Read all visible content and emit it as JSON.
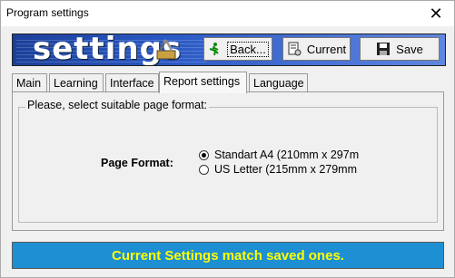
{
  "window": {
    "title": "Program settings",
    "close_glyph": "✕"
  },
  "banner": {
    "title": "settings"
  },
  "toolbar": {
    "back_label": "Back...",
    "current_label": "Current",
    "save_label": "Save"
  },
  "tabs": [
    {
      "label": "Main"
    },
    {
      "label": "Learning"
    },
    {
      "label": "Interface"
    },
    {
      "label": "Report settings",
      "active": true
    },
    {
      "label": "Language"
    }
  ],
  "panel": {
    "group_legend": "Please, select suitable page format:",
    "page_format_label": "Page Format:",
    "options": [
      {
        "label": "Standart A4 (210mm x 297m",
        "checked": true
      },
      {
        "label": "US Letter (215mm x 279mm",
        "checked": false
      }
    ]
  },
  "status": {
    "text": "Current Settings match saved ones."
  },
  "colors": {
    "banner": "#2a58c4",
    "status_bg": "#1e8fd2",
    "status_text": "#ffff00"
  }
}
